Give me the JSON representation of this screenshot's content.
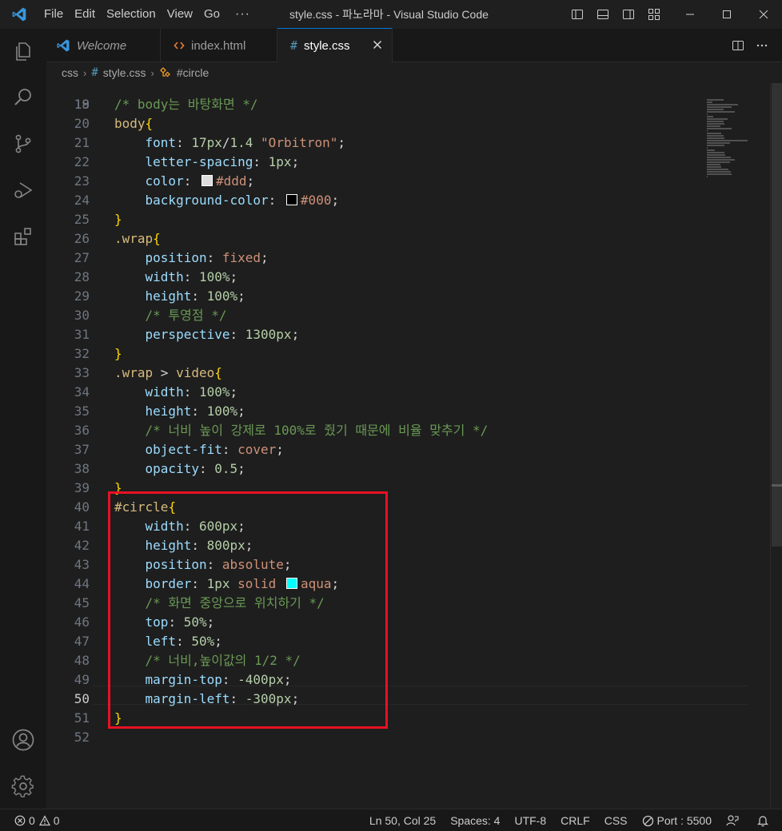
{
  "titlebar": {
    "menu": [
      "File",
      "Edit",
      "Selection",
      "View",
      "Go"
    ],
    "more": "···",
    "title": "style.css - 파노라마 - Visual Studio Code"
  },
  "tabs": [
    {
      "label": "Welcome",
      "icon": "vscode-icon"
    },
    {
      "label": "index.html",
      "icon": "html-icon"
    },
    {
      "label": "style.css",
      "icon": "css-hash-icon"
    }
  ],
  "breadcrumb": {
    "folder": "css",
    "file": "style.css",
    "symbol": "#circle"
  },
  "editor": {
    "partial_line_number": "18",
    "line_numbers": [
      "19",
      "20",
      "21",
      "22",
      "23",
      "24",
      "25",
      "26",
      "27",
      "28",
      "29",
      "30",
      "31",
      "32",
      "33",
      "34",
      "35",
      "36",
      "37",
      "38",
      "39",
      "40",
      "41",
      "42",
      "43",
      "44",
      "45",
      "46",
      "47",
      "48",
      "49",
      "50",
      "51",
      "52"
    ],
    "current_line": "50",
    "lines": [
      [
        {
          "t": "/* body는 바탕화면 */",
          "c": "comment"
        }
      ],
      [
        {
          "t": "body",
          "c": "tag"
        },
        {
          "t": "{",
          "c": "brace"
        }
      ],
      [
        {
          "t": "    "
        },
        {
          "t": "font",
          "c": "prop"
        },
        {
          "t": ": ",
          "c": "punc"
        },
        {
          "t": "17px",
          "c": "num"
        },
        {
          "t": "/",
          "c": "punc"
        },
        {
          "t": "1.4",
          "c": "num"
        },
        {
          "t": " ",
          "c": "punc"
        },
        {
          "t": "\"Orbitron\"",
          "c": "str"
        },
        {
          "t": ";",
          "c": "punc"
        }
      ],
      [
        {
          "t": "    "
        },
        {
          "t": "letter-spacing",
          "c": "prop"
        },
        {
          "t": ": ",
          "c": "punc"
        },
        {
          "t": "1px",
          "c": "num"
        },
        {
          "t": ";",
          "c": "punc"
        }
      ],
      [
        {
          "t": "    "
        },
        {
          "t": "color",
          "c": "prop"
        },
        {
          "t": ": ",
          "c": "punc"
        },
        {
          "sw": "#dddddd"
        },
        {
          "t": "#ddd",
          "c": "val"
        },
        {
          "t": ";",
          "c": "punc"
        }
      ],
      [
        {
          "t": "    "
        },
        {
          "t": "background-color",
          "c": "prop"
        },
        {
          "t": ": ",
          "c": "punc"
        },
        {
          "sw": "#000000"
        },
        {
          "t": "#000",
          "c": "val"
        },
        {
          "t": ";",
          "c": "punc"
        }
      ],
      [
        {
          "t": "}",
          "c": "brace"
        }
      ],
      [
        {
          "t": ".wrap",
          "c": "sel"
        },
        {
          "t": "{",
          "c": "brace"
        }
      ],
      [
        {
          "t": "    "
        },
        {
          "t": "position",
          "c": "prop"
        },
        {
          "t": ": ",
          "c": "punc"
        },
        {
          "t": "fixed",
          "c": "val"
        },
        {
          "t": ";",
          "c": "punc"
        }
      ],
      [
        {
          "t": "    "
        },
        {
          "t": "width",
          "c": "prop"
        },
        {
          "t": ": ",
          "c": "punc"
        },
        {
          "t": "100%",
          "c": "num"
        },
        {
          "t": ";",
          "c": "punc"
        }
      ],
      [
        {
          "t": "    "
        },
        {
          "t": "height",
          "c": "prop"
        },
        {
          "t": ": ",
          "c": "punc"
        },
        {
          "t": "100%",
          "c": "num"
        },
        {
          "t": ";",
          "c": "punc"
        }
      ],
      [
        {
          "t": "    "
        },
        {
          "t": "/* 투영점 */",
          "c": "comment"
        }
      ],
      [
        {
          "t": "    "
        },
        {
          "t": "perspective",
          "c": "prop"
        },
        {
          "t": ": ",
          "c": "punc"
        },
        {
          "t": "1300px",
          "c": "num"
        },
        {
          "t": ";",
          "c": "punc"
        }
      ],
      [
        {
          "t": "}",
          "c": "brace"
        }
      ],
      [
        {
          "t": ".wrap",
          "c": "sel"
        },
        {
          "t": " > ",
          "c": "punc"
        },
        {
          "t": "video",
          "c": "tag"
        },
        {
          "t": "{",
          "c": "brace"
        }
      ],
      [
        {
          "t": "    "
        },
        {
          "t": "width",
          "c": "prop"
        },
        {
          "t": ": ",
          "c": "punc"
        },
        {
          "t": "100%",
          "c": "num"
        },
        {
          "t": ";",
          "c": "punc"
        }
      ],
      [
        {
          "t": "    "
        },
        {
          "t": "height",
          "c": "prop"
        },
        {
          "t": ": ",
          "c": "punc"
        },
        {
          "t": "100%",
          "c": "num"
        },
        {
          "t": ";",
          "c": "punc"
        }
      ],
      [
        {
          "t": "    "
        },
        {
          "t": "/* 너비 높이 강제로 100%로 줬기 때문에 비율 맞추기 */",
          "c": "comment"
        }
      ],
      [
        {
          "t": "    "
        },
        {
          "t": "object-fit",
          "c": "prop"
        },
        {
          "t": ": ",
          "c": "punc"
        },
        {
          "t": "cover",
          "c": "val"
        },
        {
          "t": ";",
          "c": "punc"
        }
      ],
      [
        {
          "t": "    "
        },
        {
          "t": "opacity",
          "c": "prop"
        },
        {
          "t": ": ",
          "c": "punc"
        },
        {
          "t": "0.5",
          "c": "num"
        },
        {
          "t": ";",
          "c": "punc"
        }
      ],
      [
        {
          "t": "}",
          "c": "brace"
        }
      ],
      [
        {
          "t": "#circle",
          "c": "sel"
        },
        {
          "t": "{",
          "c": "brace"
        }
      ],
      [
        {
          "t": "    "
        },
        {
          "t": "width",
          "c": "prop"
        },
        {
          "t": ": ",
          "c": "punc"
        },
        {
          "t": "600px",
          "c": "num"
        },
        {
          "t": ";",
          "c": "punc"
        }
      ],
      [
        {
          "t": "    "
        },
        {
          "t": "height",
          "c": "prop"
        },
        {
          "t": ": ",
          "c": "punc"
        },
        {
          "t": "800px",
          "c": "num"
        },
        {
          "t": ";",
          "c": "punc"
        }
      ],
      [
        {
          "t": "    "
        },
        {
          "t": "position",
          "c": "prop"
        },
        {
          "t": ": ",
          "c": "punc"
        },
        {
          "t": "absolute",
          "c": "val"
        },
        {
          "t": ";",
          "c": "punc"
        }
      ],
      [
        {
          "t": "    "
        },
        {
          "t": "border",
          "c": "prop"
        },
        {
          "t": ": ",
          "c": "punc"
        },
        {
          "t": "1px",
          "c": "num"
        },
        {
          "t": " ",
          "c": "punc"
        },
        {
          "t": "solid",
          "c": "val"
        },
        {
          "t": " ",
          "c": "punc"
        },
        {
          "sw": "#00ffff"
        },
        {
          "t": "aqua",
          "c": "val"
        },
        {
          "t": ";",
          "c": "punc"
        }
      ],
      [
        {
          "t": "    "
        },
        {
          "t": "/* 화면 중앙으로 위치하기 */",
          "c": "comment"
        }
      ],
      [
        {
          "t": "    "
        },
        {
          "t": "top",
          "c": "prop"
        },
        {
          "t": ": ",
          "c": "punc"
        },
        {
          "t": "50%",
          "c": "num"
        },
        {
          "t": ";",
          "c": "punc"
        }
      ],
      [
        {
          "t": "    "
        },
        {
          "t": "left",
          "c": "prop"
        },
        {
          "t": ": ",
          "c": "punc"
        },
        {
          "t": "50%",
          "c": "num"
        },
        {
          "t": ";",
          "c": "punc"
        }
      ],
      [
        {
          "t": "    "
        },
        {
          "t": "/* 너비,높이값의 1/2 */",
          "c": "comment"
        }
      ],
      [
        {
          "t": "    "
        },
        {
          "t": "margin-top",
          "c": "prop"
        },
        {
          "t": ": ",
          "c": "punc"
        },
        {
          "t": "-400px",
          "c": "num"
        },
        {
          "t": ";",
          "c": "punc"
        }
      ],
      [
        {
          "t": "    "
        },
        {
          "t": "margin-left",
          "c": "prop"
        },
        {
          "t": ": ",
          "c": "punc"
        },
        {
          "t": "-300px",
          "c": "num"
        },
        {
          "t": ";",
          "c": "punc"
        }
      ],
      [
        {
          "t": "}",
          "c": "brace"
        }
      ],
      []
    ]
  },
  "statusbar": {
    "errors": "0",
    "warnings": "0",
    "position": "Ln 50, Col 25",
    "spaces": "Spaces: 4",
    "encoding": "UTF-8",
    "eol": "CRLF",
    "language": "CSS",
    "port": "Port : 5500"
  },
  "colors": {
    "accent": "#0078d4",
    "highlight_box": "#e81123",
    "comment": "#6a9955",
    "selector": "#d7ba7d",
    "property": "#9cdcfe",
    "number": "#b5cea8",
    "string": "#ce9178",
    "brace": "#ffd700"
  }
}
